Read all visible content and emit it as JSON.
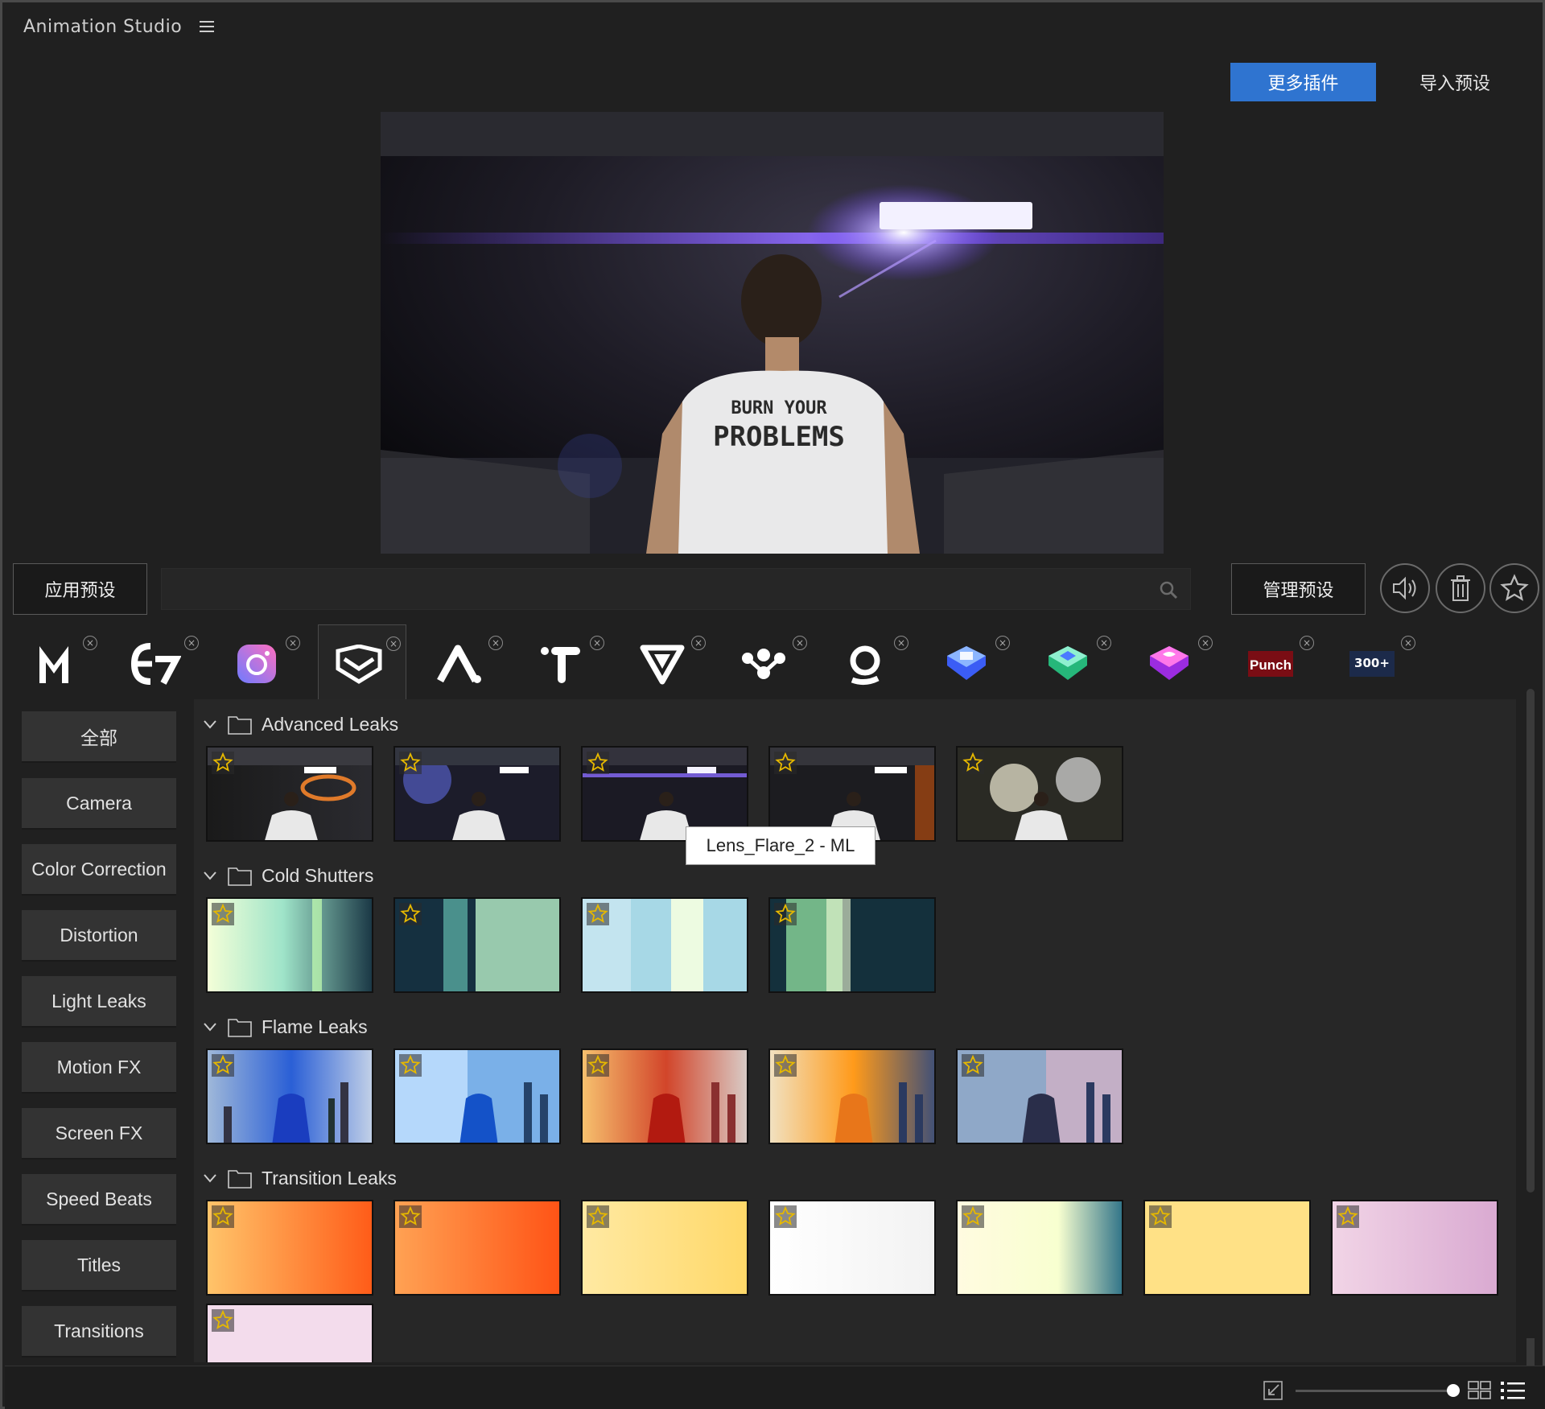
{
  "app": {
    "title": "Animation Studio"
  },
  "top_buttons": {
    "more_plugins": "更多插件",
    "import_presets": "导入预设"
  },
  "actions": {
    "apply_preset": "应用预设",
    "manage_presets": "管理预设",
    "search_placeholder": "",
    "search_value": ""
  },
  "plugins": [
    {
      "name": "M",
      "icon": "m-logo-icon"
    },
    {
      "name": "E7",
      "icon": "e7-logo-icon"
    },
    {
      "name": "Camera",
      "icon": "camera-logo-icon"
    },
    {
      "name": "Shield",
      "icon": "shield-logo-icon",
      "active": true
    },
    {
      "name": "A",
      "icon": "a-logo-icon"
    },
    {
      "name": "T",
      "icon": "t-logo-icon"
    },
    {
      "name": "V",
      "icon": "v-logo-icon"
    },
    {
      "name": "Dots",
      "icon": "dots-logo-icon"
    },
    {
      "name": "Q",
      "icon": "q-logo-icon"
    },
    {
      "name": "Blue stack",
      "icon": "blue-stack-logo-icon"
    },
    {
      "name": "Green stack",
      "icon": "green-stack-logo-icon"
    },
    {
      "name": "Purple stack",
      "icon": "purple-stack-logo-icon"
    },
    {
      "name": "Punch",
      "label": "Punch",
      "icon": "punch-logo-icon"
    },
    {
      "name": "300+",
      "label": "300+",
      "icon": "300-logo-icon"
    }
  ],
  "categories": [
    "全部",
    "Camera",
    "Color Correction",
    "Distortion",
    "Light Leaks",
    "Motion FX",
    "Screen FX",
    "Speed Beats",
    "Titles",
    "Transitions"
  ],
  "sections": [
    {
      "title": "Advanced Leaks",
      "count": 5
    },
    {
      "title": "Cold Shutters",
      "count": 4
    },
    {
      "title": "Flame Leaks",
      "count": 5
    },
    {
      "title": "Transition Leaks",
      "count": 8
    }
  ],
  "tooltip": "Lens_Flare_2 - ML",
  "colors": {
    "accent": "#2f74d0",
    "background": "#202020",
    "panel": "#272727"
  }
}
